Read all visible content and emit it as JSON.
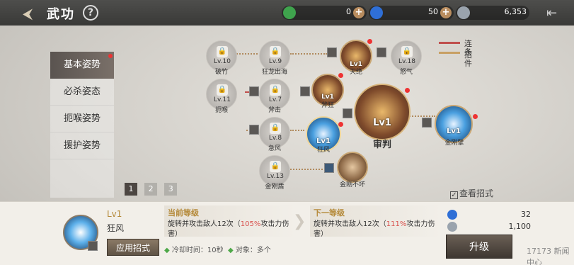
{
  "header": {
    "title": "武功",
    "back_icon": "back-arrow-icon",
    "help_label": "?"
  },
  "resources": [
    {
      "icon": "green-gem-icon",
      "color": "#3fa34d",
      "value": "0",
      "plus": "+"
    },
    {
      "icon": "blue-flame-icon",
      "color": "#2f6fd6",
      "value": "50",
      "plus": "+"
    },
    {
      "icon": "silver-coin-icon",
      "color": "#9aa3ad",
      "value": "6,353"
    }
  ],
  "tabs": [
    {
      "label": "基本姿势",
      "active": true
    },
    {
      "label": "必杀姿态"
    },
    {
      "label": "扼喉姿势"
    },
    {
      "label": "援护姿势"
    }
  ],
  "pages": [
    "1",
    "2",
    "3"
  ],
  "legend": {
    "combo": "连招",
    "condition": "条件",
    "combo_color": "#c0504d",
    "condition_color": "#c8a064"
  },
  "skill_tree": {
    "locked": [
      {
        "level": "Lv.10",
        "name": "破竹"
      },
      {
        "level": "Lv.9",
        "name": "狂龙出海"
      },
      {
        "level": "Lv.18",
        "name": "怒气"
      },
      {
        "level": "Lv.11",
        "name": "扼喉"
      },
      {
        "level": "Lv.7",
        "name": "斧击"
      },
      {
        "level": "Lv.8",
        "name": "急风"
      },
      {
        "level": "Lv.13",
        "name": "金刚盾"
      }
    ],
    "learned": [
      {
        "level": "Lv1",
        "name": "天绝"
      },
      {
        "level": "Lv1",
        "name": "斧狂"
      },
      {
        "level": "Lv1",
        "name": "狂风"
      },
      {
        "level": "Lv1",
        "name": "审判"
      },
      {
        "level": "Lv1",
        "name": "金刚擘"
      },
      {
        "name": "金刚不坏"
      }
    ]
  },
  "view_moves": "查看招式",
  "detail": {
    "level": "Lv1",
    "name": "狂风",
    "apply_label": "应用招式",
    "current": {
      "title": "当前等级",
      "text1": "旋转并攻击敌人12次（",
      "pct": "105%",
      "text2": "攻击力伤害）"
    },
    "next": {
      "title": "下一等级",
      "text1": "旋转并攻击敌人12次（",
      "pct": "111%",
      "text2": "攻击力伤害）"
    },
    "cooldown": "冷却时间：10秒",
    "target": "对象：多个",
    "cost": [
      {
        "icon": "blue-flame-icon",
        "color": "#2f6fd6",
        "value": "32"
      },
      {
        "icon": "silver-coin-icon",
        "color": "#9aa3ad",
        "value": "1,100"
      }
    ],
    "upgrade_label": "升级"
  },
  "watermark": "17173 新闻中心"
}
